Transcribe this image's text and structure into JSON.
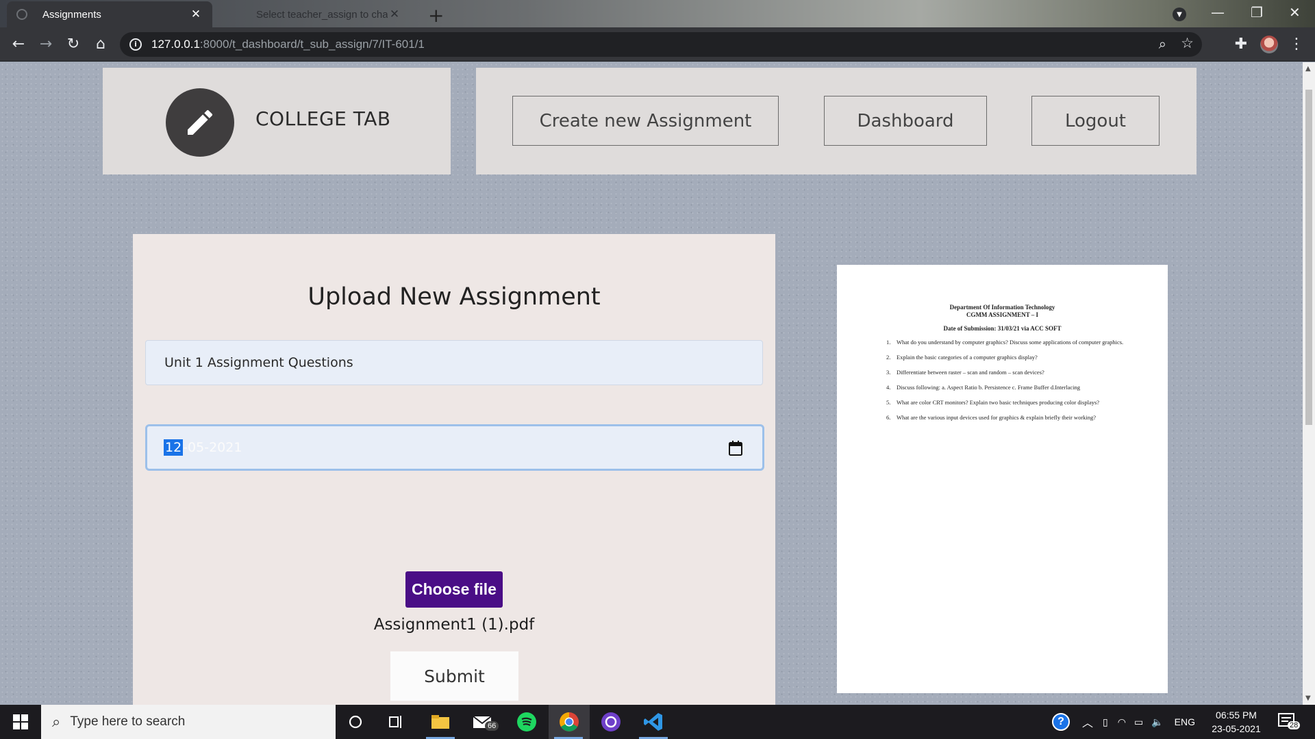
{
  "browser": {
    "tabs": [
      {
        "label": "Assignments",
        "active": true
      },
      {
        "label": "Select teacher_assign to change",
        "active": false
      }
    ],
    "url_host": "127.0.0.1",
    "url_path": ":8000/t_dashboard/t_sub_assign/7/IT-601/1"
  },
  "header": {
    "brand": "COLLEGE TAB",
    "nav": {
      "create": "Create new Assignment",
      "dashboard": "Dashboard",
      "logout": "Logout"
    }
  },
  "form": {
    "title": "Upload New Assignment",
    "assignment_name": "Unit 1 Assignment Questions",
    "date_day": "12",
    "date_rest": "-05-2021",
    "choose_file_label": "Choose file",
    "file_name": "Assignment1 (1).pdf",
    "submit_label": "Submit"
  },
  "preview": {
    "line1": "Department Of Information Technology",
    "line2": "CGMM ASSIGNMENT – I",
    "line3": "Date of Submission: 31/03/21 via ACC SOFT",
    "questions": [
      "What do you understand by computer graphics? Discuss some applications of computer graphics.",
      "Explain the basic categories of a computer graphics display?",
      "Differentiate between raster – scan and random – scan devices?",
      "Discuss following: a. Aspect Ratio b. Persistence c. Frame Buffer d.Interlacing",
      "What are color CRT monitors? Explain two basic techniques producing color displays?",
      "What are the various input devices used for graphics & explain briefly their working?"
    ]
  },
  "taskbar": {
    "search_placeholder": "Type here to search",
    "mail_badge": "66",
    "language": "ENG",
    "time": "06:55 PM",
    "date": "23-05-2021",
    "notification_count": "28"
  },
  "colors": {
    "brand_accent": "#3f3d3e",
    "choose_file_bg": "#4a0e86",
    "date_highlight": "#1a73e8"
  }
}
